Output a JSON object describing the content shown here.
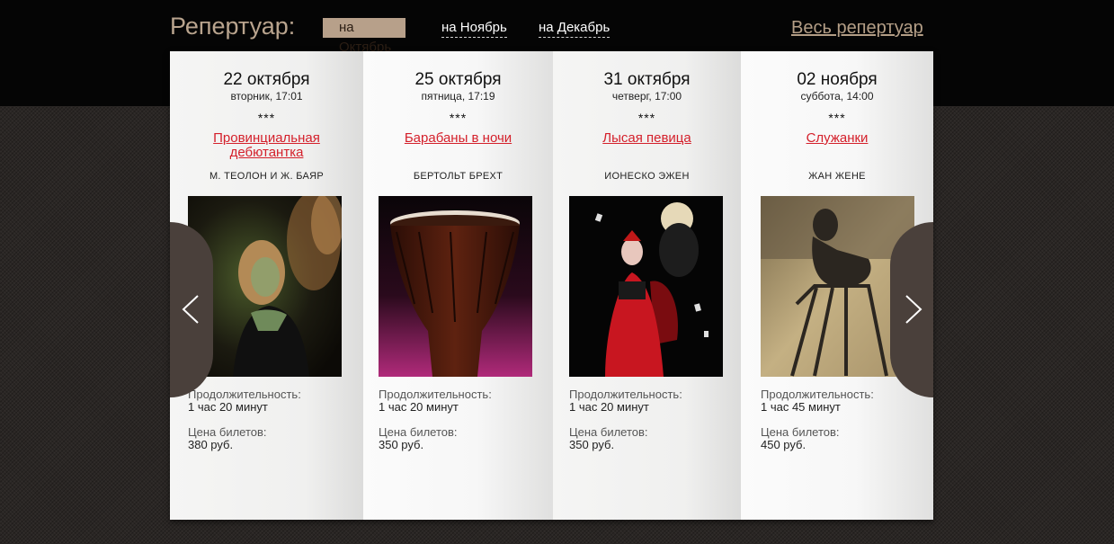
{
  "header": {
    "title": "Репертуар:",
    "months": [
      "на Октябрь",
      "на Ноябрь",
      "на Декабрь"
    ],
    "active_month": "на Октябрь",
    "all_link": "Весь репертуар"
  },
  "nav": {
    "prev_icon": "chevron-left-icon",
    "next_icon": "chevron-right-icon"
  },
  "events": [
    {
      "date": "22 октября",
      "time": "вторник, 17:01",
      "stars": "***",
      "title": "Провинциальная дебютантка",
      "author": "М. ТЕОЛОН И Ж. БАЯР",
      "duration_label": "Продолжительность:",
      "duration": "1 час 20 минут",
      "price_label": "Цена билетов:",
      "price": "380 руб."
    },
    {
      "date": "25 октября",
      "time": "пятница, 17:19",
      "stars": "***",
      "title": "Барабаны в ночи",
      "author": "БЕРТОЛЬТ БРЕХТ",
      "duration_label": "Продолжительность:",
      "duration": "1 час 20 минут",
      "price_label": "Цена билетов:",
      "price": "350 руб."
    },
    {
      "date": "31 октября",
      "time": "четверг, 17:00",
      "stars": "***",
      "title": "Лысая певица",
      "author": "ИОНЕСКО ЭЖЕН",
      "duration_label": "Продолжительность:",
      "duration": "1 час 20 минут",
      "price_label": "Цена билетов:",
      "price": "350 руб."
    },
    {
      "date": "02 ноября",
      "time": "суббота, 14:00",
      "stars": "***",
      "title": "Служанки",
      "author": "ЖАН ЖЕНЕ",
      "duration_label": "Продолжительность:",
      "duration": "1 час 45 минут",
      "price_label": "Цена билетов:",
      "price": "450 руб."
    }
  ],
  "colors": {
    "accent": "#d4202b",
    "active_tab": "#b7a08a",
    "heading": "#b9a48e",
    "arrow_bg": "#4a403b"
  }
}
